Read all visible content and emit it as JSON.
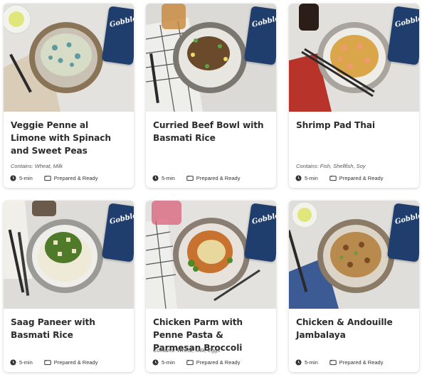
{
  "brand": "Gobble",
  "colors": {
    "card_bg": "#ffffff",
    "badge_navy": "#1f3e6e",
    "title_text": "#2d2d2d"
  },
  "meals": [
    {
      "title": "Veggie Penne al Limone with Spinach and Sweet Peas",
      "contains": "Contains: Wheat, Milk",
      "time": "5-min",
      "prep": "Prepared & Ready",
      "icon_time": "clock-icon",
      "icon_prep": "tray-icon"
    },
    {
      "title": "Curried Beef Bowl with Basmati Rice",
      "contains": "",
      "time": "5-min",
      "prep": "Prepared & Ready",
      "icon_time": "clock-icon",
      "icon_prep": "tray-icon"
    },
    {
      "title": "Shrimp Pad Thai",
      "contains": "Contains: Fish, Shellfish, Soy",
      "time": "5-min",
      "prep": "Prepared & Ready",
      "icon_time": "clock-icon",
      "icon_prep": "tray-icon"
    },
    {
      "title": "Saag Paneer with Basmati Rice",
      "contains": "",
      "time": "5-min",
      "prep": "Prepared & Ready",
      "icon_time": "clock-icon",
      "icon_prep": "tray-icon"
    },
    {
      "title": "Chicken Parm with Penne Pasta & Parmesan Broccoli",
      "contains": "Contains: Wheat, Milk, Eggs",
      "time": "5-min",
      "prep": "Prepared & Ready",
      "icon_time": "clock-icon",
      "icon_prep": "tray-icon"
    },
    {
      "title": "Chicken & Andouille Jambalaya",
      "contains": "",
      "time": "5-min",
      "prep": "Prepared & Ready",
      "icon_time": "clock-icon",
      "icon_prep": "tray-icon"
    }
  ]
}
